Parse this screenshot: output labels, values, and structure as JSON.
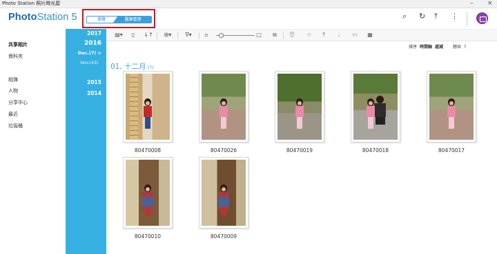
{
  "window": {
    "title": "Photo Station 照片時光屋",
    "minimize_glyph": "–",
    "close_glyph": "×"
  },
  "header": {
    "logo_bold": "Photo",
    "logo_rest": "Station 5",
    "mode_tabs": [
      {
        "label": "瀏覽",
        "active": false
      },
      {
        "label": "圖庫管理",
        "active": true
      }
    ],
    "icons": [
      "search-icon",
      "refresh-icon",
      "upload-icon",
      "more-icon",
      "user-avatar"
    ],
    "icon_glyphs": {
      "search": "⌕",
      "refresh": "↻",
      "upload": "⤒",
      "more": "⋮"
    },
    "accent_color": "#36b0e2",
    "avatar_color": "#8e44ad"
  },
  "sidebar": {
    "items": [
      {
        "label": "共享相片",
        "active": true
      },
      {
        "label": "資料夾",
        "active": false
      },
      {
        "label": "相簿",
        "active": false
      },
      {
        "label": "人物",
        "active": false
      },
      {
        "label": "分享中心",
        "active": false
      },
      {
        "label": "最近",
        "active": false
      },
      {
        "label": "垃圾桶",
        "active": false
      }
    ]
  },
  "timeline": {
    "entries": [
      {
        "label": "2017",
        "kind": "year"
      },
      {
        "label": "2016",
        "kind": "year-current"
      },
      {
        "label": "Dec.(7) >",
        "kind": "month-current"
      },
      {
        "label": "Nov.(43)",
        "kind": "month"
      },
      {
        "label": "2015",
        "kind": "year"
      },
      {
        "label": "2014",
        "kind": "year"
      }
    ]
  },
  "toolbar": {
    "glyphs": {
      "view_mode": "▤▾",
      "timeline_view": "▯",
      "sort_order": "↓↑",
      "add_menu": "⊞▾",
      "filter_menu": "∇▾",
      "size_small": "▫",
      "size_large": "□",
      "overlap": "⧉",
      "delete": "🗑",
      "rotate": "⟳",
      "upload": "⤒",
      "download": "⤓",
      "share": "⋈",
      "qr": "▦"
    }
  },
  "sort_bar": {
    "sort_label": "排序",
    "sort_field": "時間軸",
    "sort_dir": "遞減",
    "total_label": "總共",
    "total_value": "?"
  },
  "section": {
    "date_label": "01, 十二月",
    "count_label": "(7)"
  },
  "photos": [
    {
      "name": "80470008",
      "scene": "wall"
    },
    {
      "name": "80470026",
      "scene": "trees"
    },
    {
      "name": "80470019",
      "scene": "trees2"
    },
    {
      "name": "80470018",
      "scene": "trees3"
    },
    {
      "name": "80470017",
      "scene": "trees"
    },
    {
      "name": "80470010",
      "scene": "door"
    },
    {
      "name": "80470009",
      "scene": "door2"
    }
  ]
}
